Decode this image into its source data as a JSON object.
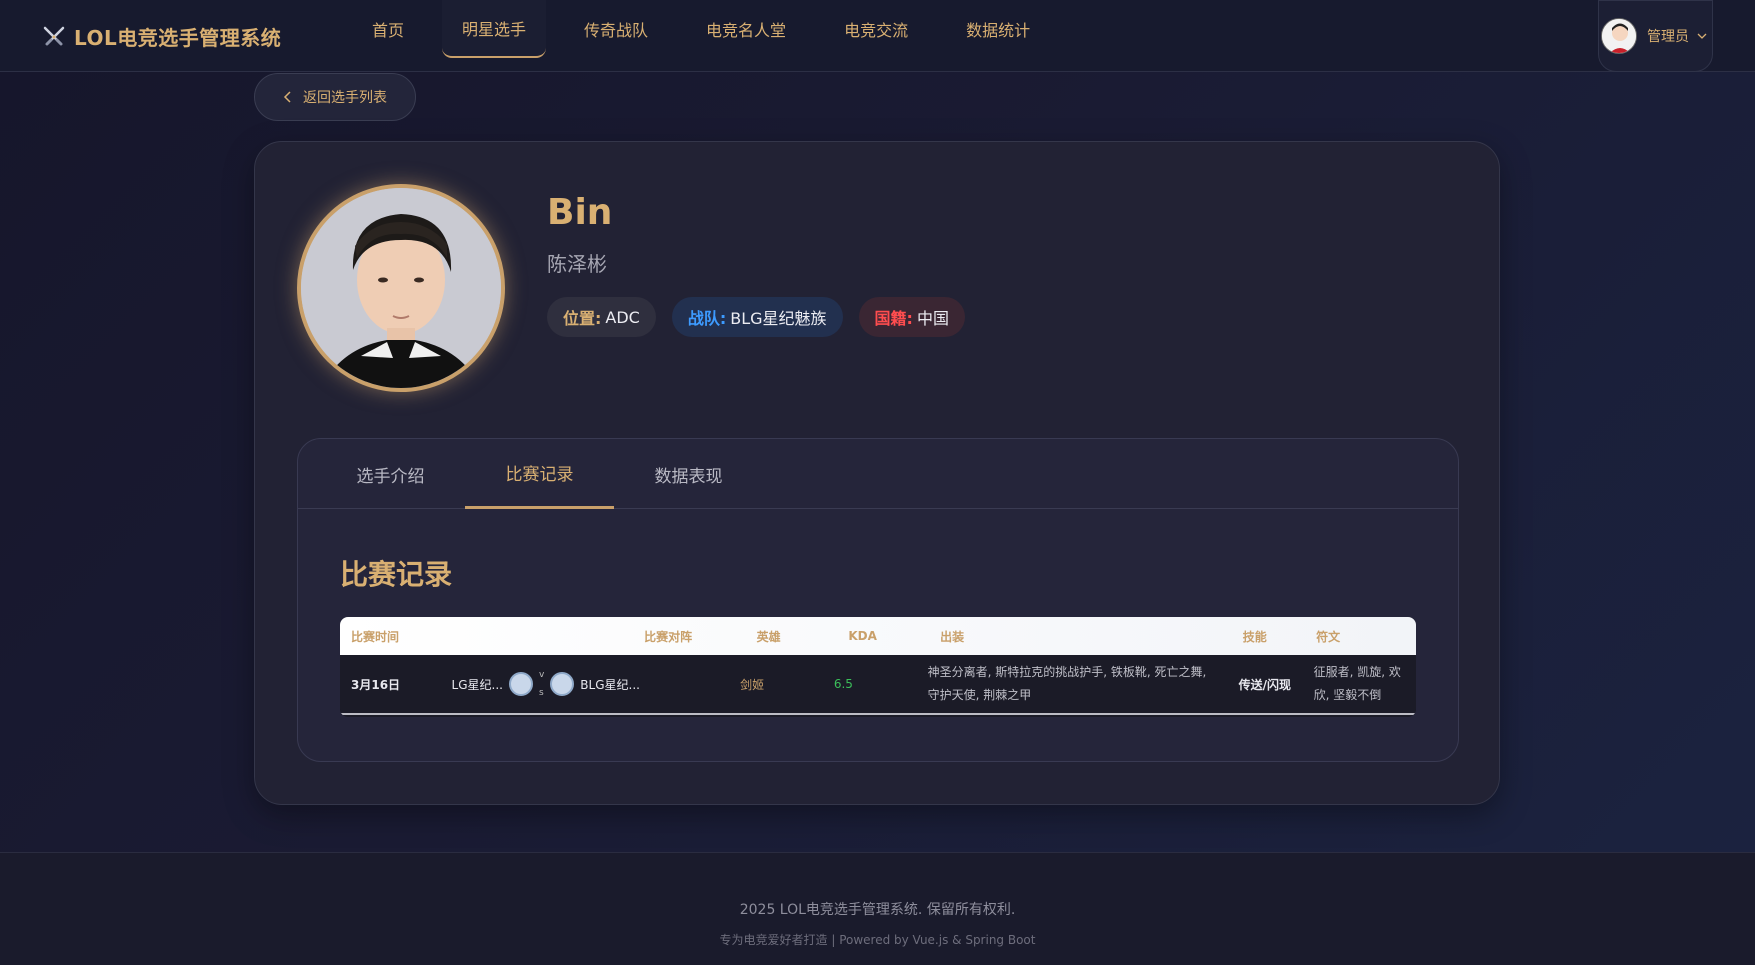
{
  "header": {
    "logo_text": "LOL电竞选手管理系统",
    "nav": [
      "首页",
      "明星选手",
      "传奇战队",
      "电竞名人堂",
      "电竞交流",
      "数据统计"
    ],
    "active_nav": "明星选手",
    "user_name": "管理员"
  },
  "back_button": "返回选手列表",
  "player": {
    "name": "Bin",
    "real_name": "陈泽彬",
    "position_label": "位置:",
    "position": "ADC",
    "team_label": "战队:",
    "team": "BLG星纪魅族",
    "nation_label": "国籍:",
    "nation": "中国"
  },
  "tabs": [
    "选手介绍",
    "比赛记录",
    "数据表现"
  ],
  "active_tab": "比赛记录",
  "section_title": "比赛记录",
  "table": {
    "headers": [
      "比赛时间",
      "比赛对阵",
      "英雄",
      "KDA",
      "出装",
      "技能",
      "符文"
    ],
    "rows": [
      {
        "date": "3月16日",
        "team_a": "LG星纪...",
        "vs_top": "v",
        "vs_bottom": "s",
        "team_b": "BLG星纪...",
        "hero": "剑姬",
        "kda": "6.5",
        "items": "神圣分离者, 斯特拉克的挑战护手, 铁板靴, 死亡之舞, 守护天使, 荆棘之甲",
        "skills": "传送/闪现",
        "runes": "征服者, 凯旋, 欢欣, 坚毅不倒"
      }
    ]
  },
  "footer": {
    "copyright": "2025 LOL电竞选手管理系统. 保留所有权利.",
    "powered": "专为电竞爱好者打造 | Powered by Vue.js & Spring Boot"
  },
  "colors": {
    "accent": "#d9b072",
    "team": "#3d9bff",
    "nation": "#ff4d4f",
    "kda": "#3bbf5a"
  }
}
